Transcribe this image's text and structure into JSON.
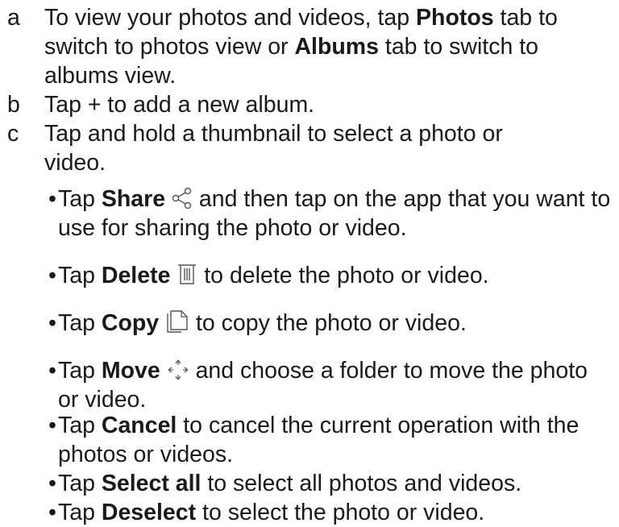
{
  "steps": [
    {
      "marker": "a",
      "part1": "To view your photos and videos, tap ",
      "bold1": "Photos",
      "part2": " tab to switch to photos view or ",
      "bold2": "Albums",
      "part3": " tab to switch to albums view."
    },
    {
      "marker": "b",
      "text": "Tap + to add a new album."
    },
    {
      "marker": "c",
      "text": "Tap and hold a thumbnail to select a photo or video."
    }
  ],
  "bullets": [
    {
      "dot": "•",
      "prefix": "Tap ",
      "bold": "Share",
      "icon": "share-icon",
      "rest": " and then tap on the app that you want to use for sharing the photo or video."
    },
    {
      "dot": "•",
      "prefix": "Tap ",
      "bold": "Delete",
      "icon": "trash-icon",
      "rest": " to delete the photo or video."
    },
    {
      "dot": "•",
      "prefix": "Tap ",
      "bold": "Copy",
      "icon": "copy-icon",
      "rest": " to copy the photo or video."
    },
    {
      "dot": "•",
      "prefix": "Tap ",
      "bold": "Move",
      "icon": "move-icon",
      "rest": " and choose a folder to move the photo or video."
    },
    {
      "dot": "•",
      "prefix": "Tap ",
      "bold": "Cancel",
      "rest": " to cancel the current operation with the photos or videos."
    },
    {
      "dot": "•",
      "prefix": "Tap ",
      "bold": "Select all",
      "rest": " to select all photos and videos."
    },
    {
      "dot": "•",
      "prefix": "Tap ",
      "bold": "Deselect",
      "rest": " to select the photo or video."
    }
  ]
}
